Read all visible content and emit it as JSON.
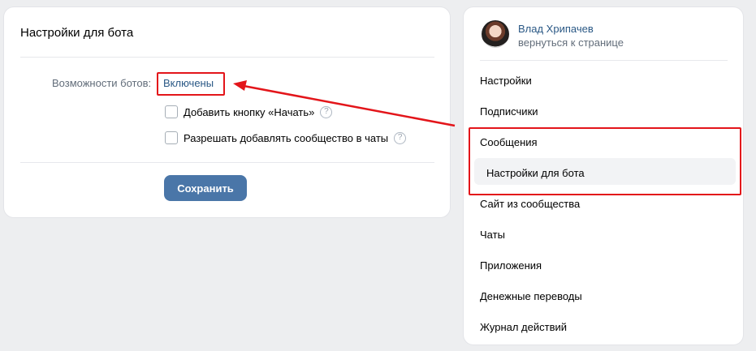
{
  "main": {
    "title": "Настройки для бота",
    "bot_capabilities_label": "Возможности ботов:",
    "bot_capabilities_value": "Включены",
    "checkboxes": [
      {
        "label": "Добавить кнопку «Начать»",
        "checked": false,
        "help_icon": "question-circle-icon"
      },
      {
        "label": "Разрешать добавлять сообщество в чаты",
        "checked": false,
        "help_icon": "question-circle-icon"
      }
    ],
    "help_glyph": "?",
    "save_label": "Сохранить"
  },
  "sidebar": {
    "user_name": "Влад Хрипачев",
    "back_link": "вернуться к странице",
    "menu": [
      {
        "label": "Настройки"
      },
      {
        "label": "Подписчики"
      },
      {
        "label": "Сообщения"
      },
      {
        "label": "Настройки для бота",
        "selected": true
      },
      {
        "label": "Сайт из сообщества"
      },
      {
        "label": "Чаты"
      },
      {
        "label": "Приложения"
      },
      {
        "label": "Денежные переводы"
      },
      {
        "label": "Журнал действий"
      }
    ]
  },
  "colors": {
    "background": "#edeef0",
    "link": "#2a5885",
    "button": "#4a76a8",
    "annotation": "#e3151a"
  }
}
